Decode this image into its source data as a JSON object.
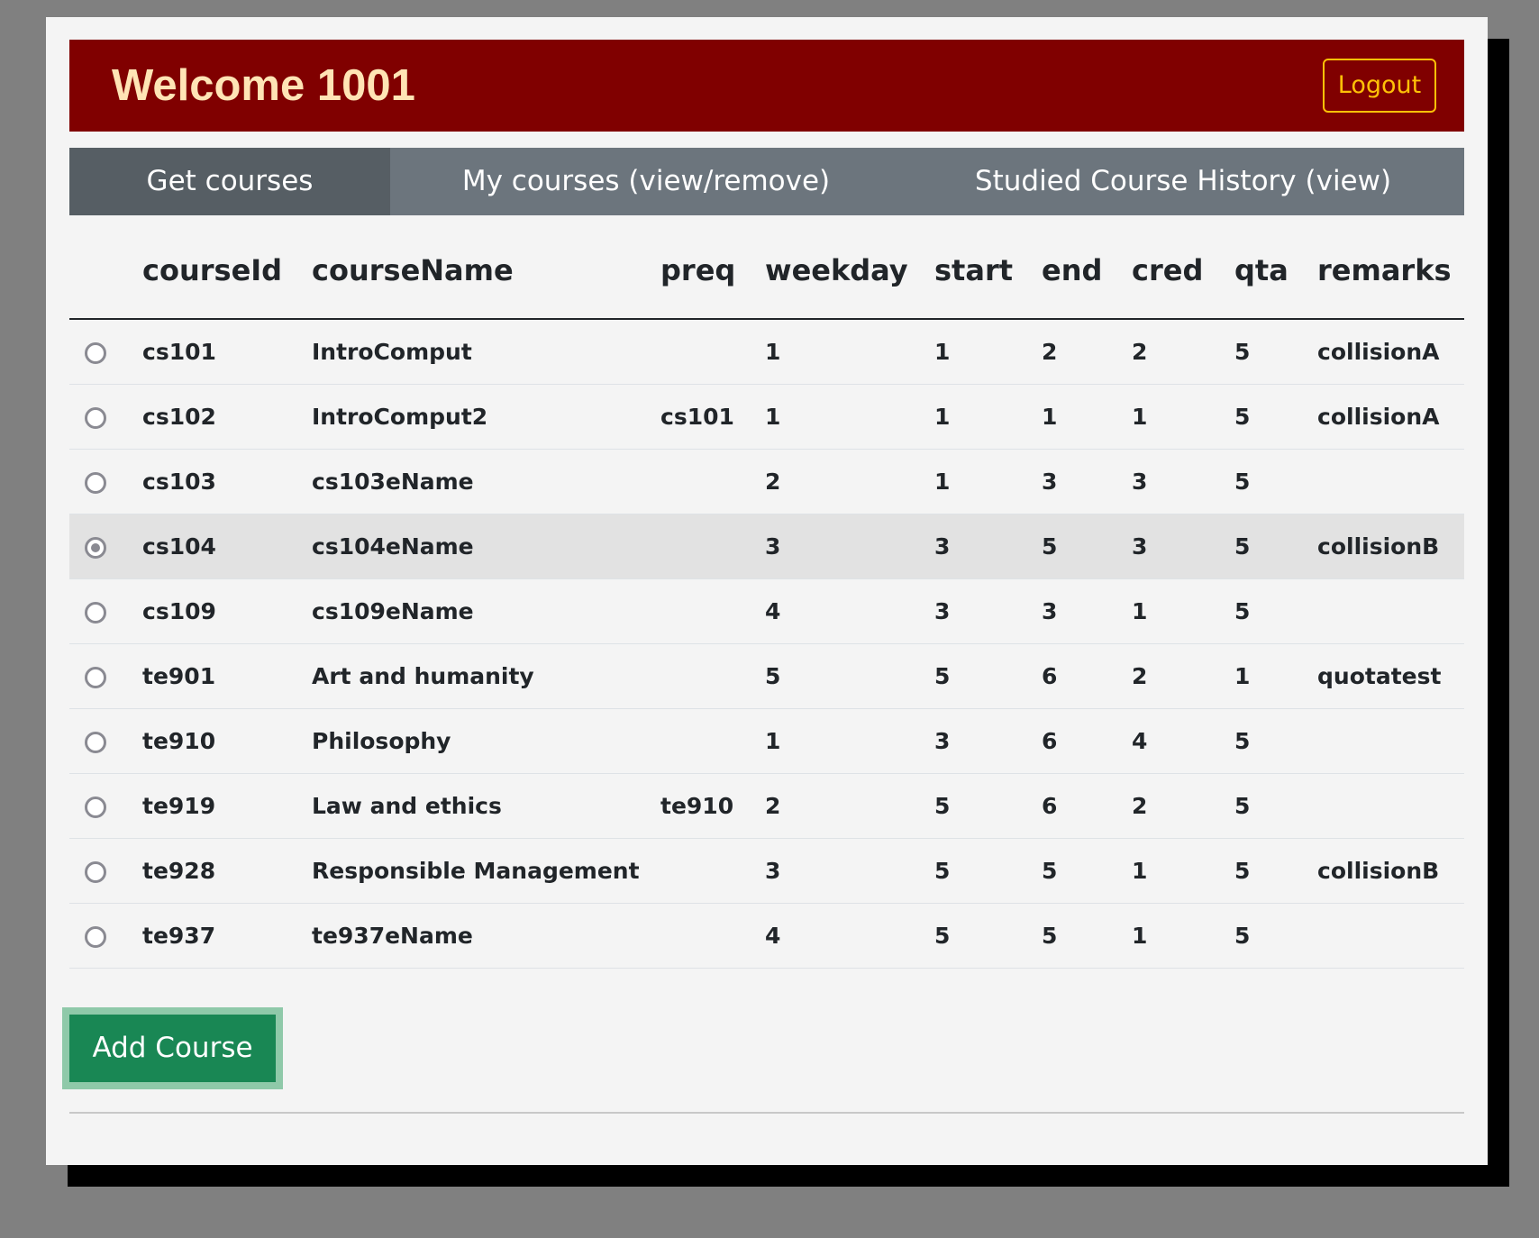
{
  "header": {
    "title": "Welcome 1001",
    "logout_label": "Logout"
  },
  "tabs": [
    {
      "label": "Get courses",
      "active": true
    },
    {
      "label": "My courses (view/remove)",
      "active": false
    },
    {
      "label": "Studied Course History (view)",
      "active": false
    }
  ],
  "table": {
    "columns": [
      "courseId",
      "courseName",
      "preq",
      "weekday",
      "start",
      "end",
      "cred",
      "qta",
      "remarks"
    ],
    "selected_course": "cs104",
    "rows": [
      {
        "courseId": "cs101",
        "courseName": "IntroComput",
        "preq": "",
        "weekday": "1",
        "start": "1",
        "end": "2",
        "cred": "2",
        "qta": "5",
        "remarks": "collisionA"
      },
      {
        "courseId": "cs102",
        "courseName": "IntroComput2",
        "preq": "cs101",
        "weekday": "1",
        "start": "1",
        "end": "1",
        "cred": "1",
        "qta": "5",
        "remarks": "collisionA"
      },
      {
        "courseId": "cs103",
        "courseName": "cs103eName",
        "preq": "",
        "weekday": "2",
        "start": "1",
        "end": "3",
        "cred": "3",
        "qta": "5",
        "remarks": ""
      },
      {
        "courseId": "cs104",
        "courseName": "cs104eName",
        "preq": "",
        "weekday": "3",
        "start": "3",
        "end": "5",
        "cred": "3",
        "qta": "5",
        "remarks": "collisionB"
      },
      {
        "courseId": "cs109",
        "courseName": "cs109eName",
        "preq": "",
        "weekday": "4",
        "start": "3",
        "end": "3",
        "cred": "1",
        "qta": "5",
        "remarks": ""
      },
      {
        "courseId": "te901",
        "courseName": "Art and humanity",
        "preq": "",
        "weekday": "5",
        "start": "5",
        "end": "6",
        "cred": "2",
        "qta": "1",
        "remarks": "quotatest"
      },
      {
        "courseId": "te910",
        "courseName": "Philosophy",
        "preq": "",
        "weekday": "1",
        "start": "3",
        "end": "6",
        "cred": "4",
        "qta": "5",
        "remarks": ""
      },
      {
        "courseId": "te919",
        "courseName": "Law and ethics",
        "preq": "te910",
        "weekday": "2",
        "start": "5",
        "end": "6",
        "cred": "2",
        "qta": "5",
        "remarks": ""
      },
      {
        "courseId": "te928",
        "courseName": "Responsible Management",
        "preq": "",
        "weekday": "3",
        "start": "5",
        "end": "5",
        "cred": "1",
        "qta": "5",
        "remarks": "collisionB"
      },
      {
        "courseId": "te937",
        "courseName": "te937eName",
        "preq": "",
        "weekday": "4",
        "start": "5",
        "end": "5",
        "cred": "1",
        "qta": "5",
        "remarks": ""
      }
    ]
  },
  "actions": {
    "add_label": "Add Course"
  },
  "colors": {
    "header_bg": "#800000",
    "header_text": "#ffe4b5",
    "logout_accent": "#ffc107",
    "tab_bg": "#6c757d",
    "tab_active_bg": "#565e64",
    "add_button_bg": "#198754",
    "add_button_focus_ring": "#8fc9a9"
  }
}
